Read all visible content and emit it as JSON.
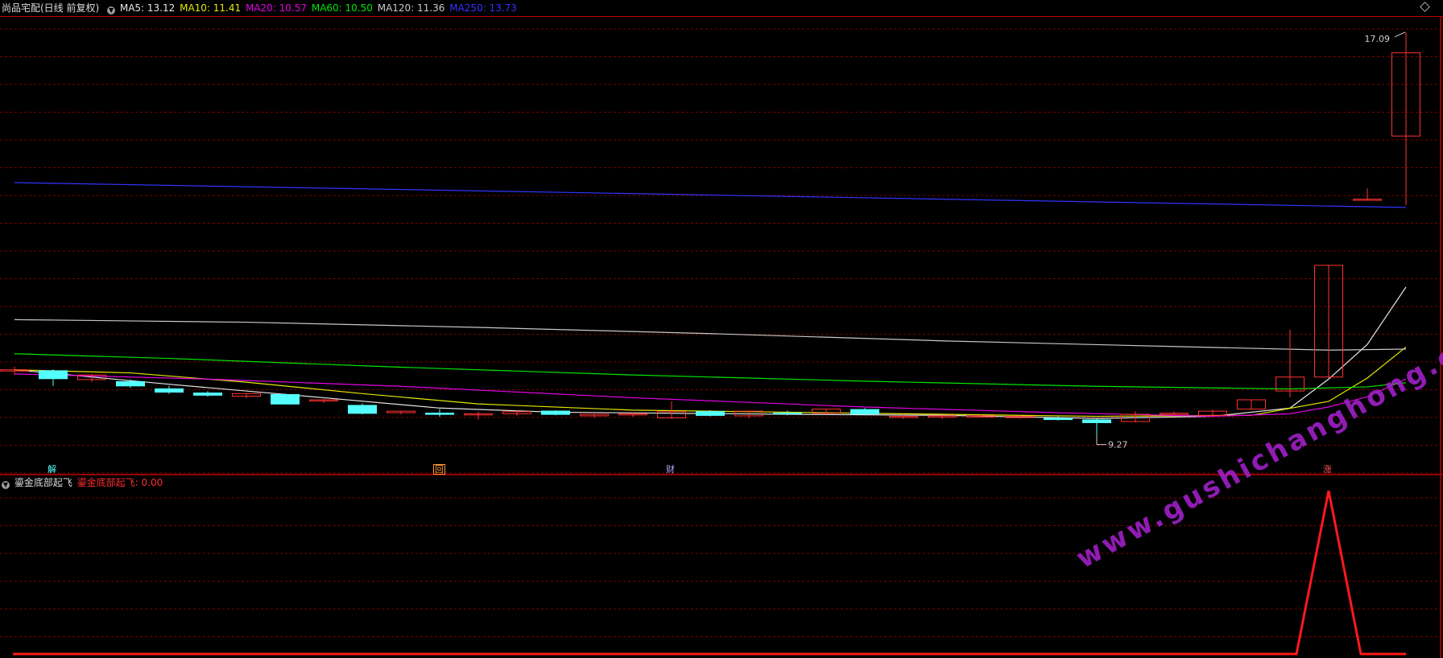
{
  "header": {
    "title": "尚品宅配(日线 前复权)",
    "ma": [
      {
        "label": "MA5: 13.12",
        "color": "#e6e6e6"
      },
      {
        "label": "MA10: 11.41",
        "color": "#e6e600"
      },
      {
        "label": "MA20: 10.57",
        "color": "#e600e6"
      },
      {
        "label": "MA60: 10.50",
        "color": "#00e600"
      },
      {
        "label": "MA120: 11.36",
        "color": "#c8c8c8"
      },
      {
        "label": "MA250: 13.73",
        "color": "#3333ff"
      }
    ]
  },
  "indicator": {
    "name": "鎏金底部起飞",
    "value_label": "鎏金底部起飞: 0.00"
  },
  "markers": [
    {
      "text": "解",
      "color": "#55ffff"
    },
    {
      "text": "回",
      "color": "#ff9933"
    },
    {
      "text": "财",
      "color": "#aaaaff"
    },
    {
      "text": "涨",
      "color": "#ff5555"
    }
  ],
  "watermark": "www.gushichanghong.com",
  "chart_data": {
    "type": "candlestick",
    "price_range": [
      9.0,
      17.4
    ],
    "annotations": {
      "high": "17.09",
      "low": "9.27"
    },
    "candles": [
      {
        "o": 10.56,
        "h": 10.62,
        "l": 10.46,
        "c": 10.56
      },
      {
        "o": 10.55,
        "h": 10.57,
        "l": 10.25,
        "c": 10.38
      },
      {
        "o": 10.37,
        "h": 10.48,
        "l": 10.32,
        "c": 10.46
      },
      {
        "o": 10.34,
        "h": 10.37,
        "l": 10.21,
        "c": 10.24
      },
      {
        "o": 10.2,
        "h": 10.25,
        "l": 10.09,
        "c": 10.12
      },
      {
        "o": 10.12,
        "h": 10.15,
        "l": 10.04,
        "c": 10.06
      },
      {
        "o": 10.05,
        "h": 10.1,
        "l": 10.01,
        "c": 10.1
      },
      {
        "o": 10.09,
        "h": 10.1,
        "l": 9.89,
        "c": 9.89
      },
      {
        "o": 9.98,
        "h": 10.0,
        "l": 9.92,
        "c": 9.98
      },
      {
        "o": 9.88,
        "h": 9.91,
        "l": 9.7,
        "c": 9.71
      },
      {
        "o": 9.73,
        "h": 9.77,
        "l": 9.7,
        "c": 9.76
      },
      {
        "o": 9.73,
        "h": 9.8,
        "l": 9.65,
        "c": 9.69
      },
      {
        "o": 9.71,
        "h": 9.75,
        "l": 9.6,
        "c": 9.71
      },
      {
        "o": 9.71,
        "h": 9.77,
        "l": 9.67,
        "c": 9.75
      },
      {
        "o": 9.77,
        "h": 9.78,
        "l": 9.68,
        "c": 9.69
      },
      {
        "o": 9.67,
        "h": 9.71,
        "l": 9.63,
        "c": 9.7
      },
      {
        "o": 9.69,
        "h": 9.74,
        "l": 9.65,
        "c": 9.71
      },
      {
        "o": 9.63,
        "h": 9.95,
        "l": 9.61,
        "c": 9.75
      },
      {
        "o": 9.76,
        "h": 9.78,
        "l": 9.66,
        "c": 9.67
      },
      {
        "o": 9.67,
        "h": 9.77,
        "l": 9.62,
        "c": 9.76
      },
      {
        "o": 9.73,
        "h": 9.77,
        "l": 9.68,
        "c": 9.7
      },
      {
        "o": 9.72,
        "h": 9.8,
        "l": 9.7,
        "c": 9.8
      },
      {
        "o": 9.8,
        "h": 9.82,
        "l": 9.68,
        "c": 9.7
      },
      {
        "o": 9.66,
        "h": 9.7,
        "l": 9.61,
        "c": 9.66
      },
      {
        "o": 9.67,
        "h": 9.68,
        "l": 9.6,
        "c": 9.67
      },
      {
        "o": 9.67,
        "h": 9.7,
        "l": 9.64,
        "c": 9.67
      },
      {
        "o": 9.66,
        "h": 9.68,
        "l": 9.61,
        "c": 9.66
      },
      {
        "o": 9.63,
        "h": 9.66,
        "l": 9.58,
        "c": 9.59
      },
      {
        "o": 9.6,
        "h": 9.62,
        "l": 9.27,
        "c": 9.53
      },
      {
        "o": 9.56,
        "h": 9.76,
        "l": 9.54,
        "c": 9.7
      },
      {
        "o": 9.72,
        "h": 9.75,
        "l": 9.68,
        "c": 9.72
      },
      {
        "o": 9.68,
        "h": 9.79,
        "l": 9.66,
        "c": 9.76
      },
      {
        "o": 9.8,
        "h": 9.98,
        "l": 9.79,
        "c": 9.98
      },
      {
        "o": 10.15,
        "h": 11.34,
        "l": 10.03,
        "c": 10.42
      },
      {
        "o": 10.42,
        "h": 12.59,
        "l": 10.4,
        "c": 12.58
      },
      {
        "o": 13.86,
        "h": 14.07,
        "l": 13.83,
        "c": 13.86
      },
      {
        "o": 15.08,
        "h": 17.09,
        "l": 13.74,
        "c": 16.69
      }
    ],
    "ma_series": [
      {
        "name": "MA5",
        "color": "#e6e6e6",
        "points": [
          [
            0,
            10.56
          ],
          [
            4,
            10.28
          ],
          [
            8,
            10.02
          ],
          [
            11,
            9.82
          ],
          [
            14,
            9.74
          ],
          [
            20,
            9.7
          ],
          [
            24,
            9.68
          ],
          [
            28,
            9.62
          ],
          [
            31,
            9.66
          ],
          [
            33,
            9.82
          ],
          [
            34,
            10.38
          ],
          [
            35,
            11.05
          ],
          [
            36,
            12.16
          ]
        ]
      },
      {
        "name": "MA10",
        "color": "#e6e600",
        "points": [
          [
            0,
            10.56
          ],
          [
            3,
            10.5
          ],
          [
            6,
            10.32
          ],
          [
            9,
            10.1
          ],
          [
            12,
            9.9
          ],
          [
            16,
            9.78
          ],
          [
            22,
            9.72
          ],
          [
            28,
            9.66
          ],
          [
            32,
            9.68
          ],
          [
            34,
            9.95
          ],
          [
            35,
            10.4
          ],
          [
            36,
            11.0
          ]
        ]
      },
      {
        "name": "MA20",
        "color": "#e600e6",
        "points": [
          [
            0,
            10.48
          ],
          [
            5,
            10.38
          ],
          [
            10,
            10.24
          ],
          [
            16,
            10.02
          ],
          [
            22,
            9.84
          ],
          [
            27,
            9.73
          ],
          [
            31,
            9.66
          ],
          [
            33,
            9.71
          ],
          [
            34,
            9.84
          ],
          [
            35,
            10.04
          ],
          [
            36,
            10.38
          ]
        ]
      },
      {
        "name": "MA60",
        "color": "#00e600",
        "points": [
          [
            0,
            10.87
          ],
          [
            4,
            10.78
          ],
          [
            10,
            10.61
          ],
          [
            16,
            10.46
          ],
          [
            22,
            10.34
          ],
          [
            28,
            10.24
          ],
          [
            33,
            10.19
          ],
          [
            35,
            10.23
          ],
          [
            36,
            10.31
          ]
        ]
      },
      {
        "name": "MA120",
        "color": "#c8c8c8",
        "points": [
          [
            0,
            11.53
          ],
          [
            6,
            11.48
          ],
          [
            12,
            11.38
          ],
          [
            18,
            11.26
          ],
          [
            24,
            11.12
          ],
          [
            30,
            11.01
          ],
          [
            34,
            10.94
          ],
          [
            36,
            10.96
          ]
        ]
      },
      {
        "name": "MA250",
        "color": "#3333ff",
        "points": [
          [
            0,
            14.18
          ],
          [
            36,
            13.7
          ]
        ]
      }
    ],
    "indicator_values": [
      0,
      0,
      0,
      0,
      0,
      0,
      0,
      0,
      0,
      0,
      0,
      0,
      0,
      0,
      0,
      0,
      0,
      0,
      0,
      0,
      0,
      0,
      0,
      0,
      0,
      0,
      0,
      0,
      0,
      0,
      0,
      0,
      0,
      0,
      1,
      0,
      0
    ]
  }
}
